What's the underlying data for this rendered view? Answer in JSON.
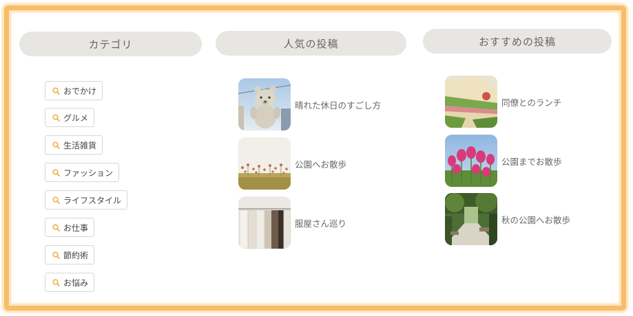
{
  "categories": {
    "heading": "カテゴリ",
    "items": [
      {
        "label": "おでかけ"
      },
      {
        "label": "グルメ"
      },
      {
        "label": "生活雑貨"
      },
      {
        "label": "ファッション"
      },
      {
        "label": "ライフスタイル"
      },
      {
        "label": "お仕事"
      },
      {
        "label": "節約術"
      },
      {
        "label": "お悩み"
      }
    ],
    "icon": "search-icon",
    "icon_color": "#f0b040"
  },
  "popular": {
    "heading": "人気の投稿",
    "posts": [
      {
        "title": "晴れた休日のすごし方",
        "image": "teddy-bear-photo"
      },
      {
        "title": "公園へお散歩",
        "image": "flower-field-photo"
      },
      {
        "title": "服屋さん巡り",
        "image": "clothes-rack-photo"
      }
    ]
  },
  "recommended": {
    "heading": "おすすめの投稿",
    "posts": [
      {
        "title": "同僚とのランチ",
        "image": "sandwich-photo"
      },
      {
        "title": "公園までお散歩",
        "image": "tulips-photo"
      },
      {
        "title": "秋の公園へお散歩",
        "image": "park-path-photo"
      }
    ]
  },
  "colors": {
    "frame": "#f7bd6a",
    "heading_bg": "#e8e6e3"
  }
}
